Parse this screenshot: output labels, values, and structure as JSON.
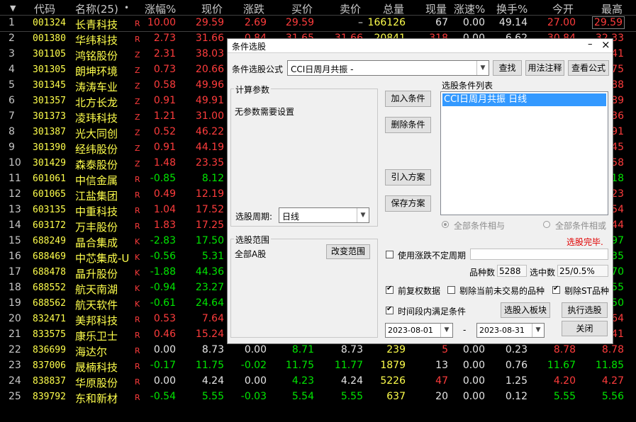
{
  "table": {
    "sort_arrow": "▼",
    "headers": {
      "code": "代码",
      "name": "名称(25)",
      "dot": "•",
      "chg_pct": "涨幅%",
      "price": "现价",
      "chg": "涨跌",
      "bid": "买价",
      "ask": "卖价",
      "volume": "总量",
      "cur_vol": "现量",
      "speed": "涨速%",
      "turnover": "换手%",
      "open": "今开",
      "high": "最高"
    },
    "rows": [
      {
        "idx": "1",
        "code": "001324",
        "name": "长青科技",
        "tag": "R",
        "chg_pct": "10.00",
        "price": "29.59",
        "chg": "2.69",
        "bid": "29.59",
        "ask": "–",
        "volume": "166126",
        "cur_vol": "67",
        "speed": "0.00",
        "turnover": "49.14",
        "open": "27.00",
        "high": "29.59",
        "dir": "red"
      },
      {
        "idx": "2",
        "code": "001380",
        "name": "华纬科技",
        "tag": "R",
        "chg_pct": "2.73",
        "price": "31.66",
        "chg": "0.84",
        "bid": "31.65",
        "ask": "31.66",
        "volume": "20841",
        "cur_vol": "318",
        "speed": "0.00",
        "turnover": "6.62",
        "open": "30.84",
        "high": "32.33",
        "dir": "red"
      },
      {
        "idx": "3",
        "code": "301105",
        "name": "鸿铭股份",
        "tag": "Z",
        "chg_pct": "2.31",
        "price": "38.03",
        "chg": "",
        "bid": "",
        "ask": "",
        "volume": "",
        "cur_vol": "",
        "speed": "",
        "turnover": "",
        "open": "",
        "high": "41",
        "dir": "red"
      },
      {
        "idx": "4",
        "code": "301305",
        "name": "朗坤环境",
        "tag": "Z",
        "chg_pct": "0.73",
        "price": "20.66",
        "chg": "",
        "bid": "",
        "ask": "",
        "volume": "",
        "cur_vol": "",
        "speed": "",
        "turnover": "",
        "open": "",
        "high": "75",
        "dir": "red"
      },
      {
        "idx": "5",
        "code": "301345",
        "name": "涛涛车业",
        "tag": "Z",
        "chg_pct": "0.58",
        "price": "49.96",
        "chg": "",
        "bid": "",
        "ask": "",
        "volume": "",
        "cur_vol": "",
        "speed": "",
        "turnover": "",
        "open": "",
        "high": "88",
        "dir": "red"
      },
      {
        "idx": "6",
        "code": "301357",
        "name": "北方长龙",
        "tag": "Z",
        "chg_pct": "0.91",
        "price": "49.91",
        "chg": "",
        "bid": "",
        "ask": "",
        "volume": "",
        "cur_vol": "",
        "speed": "",
        "turnover": "",
        "open": "",
        "high": "89",
        "dir": "red"
      },
      {
        "idx": "7",
        "code": "301373",
        "name": "凌玮科技",
        "tag": "Z",
        "chg_pct": "1.21",
        "price": "31.00",
        "chg": "",
        "bid": "",
        "ask": "",
        "volume": "",
        "cur_vol": "",
        "speed": "",
        "turnover": "",
        "open": "",
        "high": "36",
        "dir": "red"
      },
      {
        "idx": "8",
        "code": "301387",
        "name": "光大同创",
        "tag": "Z",
        "chg_pct": "0.52",
        "price": "46.22",
        "chg": "",
        "bid": "",
        "ask": "",
        "volume": "",
        "cur_vol": "",
        "speed": "",
        "turnover": "",
        "open": "",
        "high": "91",
        "dir": "red"
      },
      {
        "idx": "9",
        "code": "301390",
        "name": "经纬股份",
        "tag": "Z",
        "chg_pct": "0.91",
        "price": "44.19",
        "chg": "",
        "bid": "",
        "ask": "",
        "volume": "",
        "cur_vol": "",
        "speed": "",
        "turnover": "",
        "open": "",
        "high": "45",
        "dir": "red"
      },
      {
        "idx": "10",
        "code": "301429",
        "name": "森泰股份",
        "tag": "Z",
        "chg_pct": "1.48",
        "price": "23.35",
        "chg": "",
        "bid": "",
        "ask": "",
        "volume": "",
        "cur_vol": "",
        "speed": "",
        "turnover": "",
        "open": "",
        "high": "58",
        "dir": "red"
      },
      {
        "idx": "11",
        "code": "601061",
        "name": "中信金属",
        "tag": "R",
        "chg_pct": "-0.85",
        "price": "8.12",
        "chg": "",
        "bid": "",
        "ask": "",
        "volume": "",
        "cur_vol": "",
        "speed": "",
        "turnover": "",
        "open": "",
        "high": "18",
        "dir": "green"
      },
      {
        "idx": "12",
        "code": "601065",
        "name": "江盐集团",
        "tag": "R",
        "chg_pct": "0.49",
        "price": "12.19",
        "chg": "",
        "bid": "",
        "ask": "",
        "volume": "",
        "cur_vol": "",
        "speed": "",
        "turnover": "",
        "open": "",
        "high": "23",
        "dir": "red"
      },
      {
        "idx": "13",
        "code": "603135",
        "name": "中重科技",
        "tag": "R",
        "chg_pct": "1.04",
        "price": "17.52",
        "chg": "",
        "bid": "",
        "ask": "",
        "volume": "",
        "cur_vol": "",
        "speed": "",
        "turnover": "",
        "open": "",
        "high": "54",
        "dir": "red"
      },
      {
        "idx": "14",
        "code": "603172",
        "name": "万丰股份",
        "tag": "R",
        "chg_pct": "1.83",
        "price": "17.25",
        "chg": "",
        "bid": "",
        "ask": "",
        "volume": "",
        "cur_vol": "",
        "speed": "",
        "turnover": "",
        "open": "",
        "high": "44",
        "dir": "red"
      },
      {
        "idx": "15",
        "code": "688249",
        "name": "晶合集成",
        "tag": "K",
        "chg_pct": "-2.83",
        "price": "17.50",
        "chg": "",
        "bid": "",
        "ask": "",
        "volume": "",
        "cur_vol": "",
        "speed": "",
        "turnover": "",
        "open": "",
        "high": "97",
        "dir": "green"
      },
      {
        "idx": "16",
        "code": "688469",
        "name": "中芯集成-U",
        "tag": "K",
        "chg_pct": "-0.56",
        "price": "5.31",
        "chg": "",
        "bid": "",
        "ask": "",
        "volume": "",
        "cur_vol": "",
        "speed": "",
        "turnover": "",
        "open": "",
        "high": "35",
        "dir": "green"
      },
      {
        "idx": "17",
        "code": "688478",
        "name": "晶升股份",
        "tag": "K",
        "chg_pct": "-1.88",
        "price": "44.36",
        "chg": "",
        "bid": "",
        "ask": "",
        "volume": "",
        "cur_vol": "",
        "speed": "",
        "turnover": "",
        "open": "",
        "high": "70",
        "dir": "green"
      },
      {
        "idx": "18",
        "code": "688552",
        "name": "航天南湖",
        "tag": "K",
        "chg_pct": "-0.94",
        "price": "23.27",
        "chg": "",
        "bid": "",
        "ask": "",
        "volume": "",
        "cur_vol": "",
        "speed": "",
        "turnover": "",
        "open": "",
        "high": "55",
        "dir": "green"
      },
      {
        "idx": "19",
        "code": "688562",
        "name": "航天软件",
        "tag": "K",
        "chg_pct": "-0.61",
        "price": "24.64",
        "chg": "",
        "bid": "",
        "ask": "",
        "volume": "",
        "cur_vol": "",
        "speed": "",
        "turnover": "",
        "open": "",
        "high": "50",
        "dir": "green"
      },
      {
        "idx": "20",
        "code": "832471",
        "name": "美邦科技",
        "tag": "R",
        "chg_pct": "0.53",
        "price": "7.64",
        "chg": "",
        "bid": "",
        "ask": "",
        "volume": "",
        "cur_vol": "",
        "speed": "",
        "turnover": "",
        "open": "",
        "high": "64",
        "dir": "red"
      },
      {
        "idx": "21",
        "code": "833575",
        "name": "康乐卫士",
        "tag": "R",
        "chg_pct": "0.46",
        "price": "15.24",
        "chg": "",
        "bid": "",
        "ask": "",
        "volume": "",
        "cur_vol": "",
        "speed": "",
        "turnover": "",
        "open": "",
        "high": "41",
        "dir": "red"
      },
      {
        "idx": "22",
        "code": "836699",
        "name": "海达尔",
        "tag": "R",
        "chg_pct": "0.00",
        "price": "8.73",
        "chg": "0.00",
        "bid": "8.71",
        "ask": "8.73",
        "volume": "239",
        "cur_vol": "5",
        "speed": "0.00",
        "turnover": "0.23",
        "open": "8.78",
        "high": "8.78",
        "dir": "flat"
      },
      {
        "idx": "23",
        "code": "837006",
        "name": "晟楠科技",
        "tag": "R",
        "chg_pct": "-0.17",
        "price": "11.75",
        "chg": "-0.02",
        "bid": "11.75",
        "ask": "11.77",
        "volume": "1879",
        "cur_vol": "13",
        "speed": "0.00",
        "turnover": "0.76",
        "open": "11.67",
        "high": "11.85",
        "dir": "green"
      },
      {
        "idx": "24",
        "code": "838837",
        "name": "华原股份",
        "tag": "R",
        "chg_pct": "0.00",
        "price": "4.24",
        "chg": "0.00",
        "bid": "4.23",
        "ask": "4.24",
        "volume": "5226",
        "cur_vol": "47",
        "speed": "0.00",
        "turnover": "1.25",
        "open": "4.20",
        "high": "4.27",
        "dir": "flat"
      },
      {
        "idx": "25",
        "code": "839792",
        "name": "东和新材",
        "tag": "R",
        "chg_pct": "-0.54",
        "price": "5.55",
        "chg": "-0.03",
        "bid": "5.54",
        "ask": "5.55",
        "volume": "637",
        "cur_vol": "20",
        "speed": "0.00",
        "turnover": "0.12",
        "open": "5.55",
        "high": "5.56",
        "dir": "green"
      }
    ]
  },
  "dialog": {
    "title": "条件选股",
    "min_btn": "–",
    "close_btn": "×",
    "formula_label": "条件选股公式",
    "formula_value": "CCI日周月共振 -",
    "btn_find": "查找",
    "btn_usage": "用法注释",
    "btn_view_formula": "查看公式",
    "params_group": "计算参数",
    "params_text": "无参数需要设置",
    "period_label": "选股周期:",
    "period_value": "日线",
    "btn_add": "加入条件",
    "btn_delete": "删除条件",
    "btn_import": "引入方案",
    "btn_save": "保存方案",
    "cond_list_label": "选股条件列表",
    "cond_items": [
      "CCI日周月共振  日线"
    ],
    "radio_and": "全部条件相与",
    "radio_or": "全部条件相或",
    "status": "选股完毕.",
    "scope_group": "选股范围",
    "scope_value": "全部A股",
    "btn_change_scope": "改变范围",
    "cb_variable_period": "使用涨跌不定周期",
    "count_label": "品种数",
    "count_value": "5288",
    "selected_label": "选中数",
    "selected_value": "25/0.5%",
    "cb_adjust": "前复权数据",
    "cb_exclude_untraded": "剔除当前未交易的品种",
    "cb_exclude_st": "剔除ST品种",
    "cb_period_satisfy": "时间段内满足条件",
    "btn_to_block": "选股入板块",
    "btn_execute": "执行选股",
    "date_from": "2023-08-01",
    "date_sep": "-",
    "date_to": "2023-08-31",
    "btn_close": "关闭",
    "colors": {
      "highlight": "#3399ff",
      "status_red": "#e00000"
    }
  }
}
